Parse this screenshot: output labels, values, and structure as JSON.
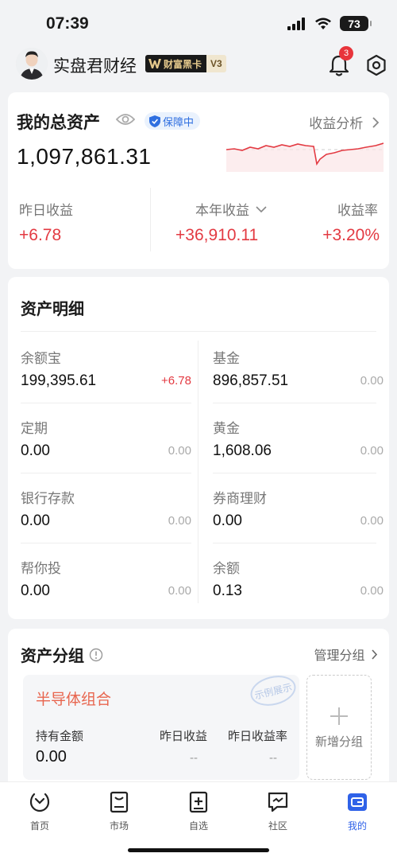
{
  "status_bar": {
    "time": "07:39",
    "battery": "73"
  },
  "header": {
    "user_name": "实盘君财经",
    "vip_label": "财富黑卡",
    "vip_level": "V3",
    "notification_count": "3"
  },
  "overview": {
    "title": "我的总资产",
    "protection_label": "保障中",
    "analysis_link": "收益分析",
    "total_assets": "1,097,861.31",
    "stats": [
      {
        "label": "昨日收益",
        "value": "+6.78"
      },
      {
        "label": "本年收益",
        "value": "+36,910.11"
      },
      {
        "label": "收益率",
        "value": "+3.20%"
      }
    ],
    "colors": {
      "up": "#e33a42",
      "protect": "#2f6fe0"
    }
  },
  "asset_detail": {
    "title": "资产明细",
    "left": [
      {
        "name": "余额宝",
        "value": "199,395.61",
        "change": "+6.78"
      },
      {
        "name": "定期",
        "value": "0.00",
        "change": "0.00"
      },
      {
        "name": "银行存款",
        "value": "0.00",
        "change": "0.00"
      },
      {
        "name": "帮你投",
        "value": "0.00",
        "change": "0.00"
      }
    ],
    "right": [
      {
        "name": "基金",
        "value": "896,857.51",
        "change": "0.00"
      },
      {
        "name": "黄金",
        "value": "1,608.06",
        "change": "0.00"
      },
      {
        "name": "券商理财",
        "value": "0.00",
        "change": "0.00"
      },
      {
        "name": "余额",
        "value": "0.13",
        "change": "0.00"
      }
    ]
  },
  "asset_groups": {
    "title": "资产分组",
    "manage_link": "管理分组",
    "group": {
      "name": "半导体组合",
      "stamp": "示例展示",
      "labels": [
        "持有金额",
        "昨日收益",
        "昨日收益率"
      ],
      "values": [
        "0.00",
        "--",
        "--"
      ]
    },
    "add_label": "新增分组"
  },
  "tabbar": {
    "items": [
      {
        "label": "首页",
        "icon": "home-icon"
      },
      {
        "label": "市场",
        "icon": "market-icon"
      },
      {
        "label": "自选",
        "icon": "watchlist-icon"
      },
      {
        "label": "社区",
        "icon": "community-icon"
      },
      {
        "label": "我的",
        "icon": "wallet-icon"
      }
    ],
    "active": "我的",
    "active_color": "#2f62e8"
  }
}
